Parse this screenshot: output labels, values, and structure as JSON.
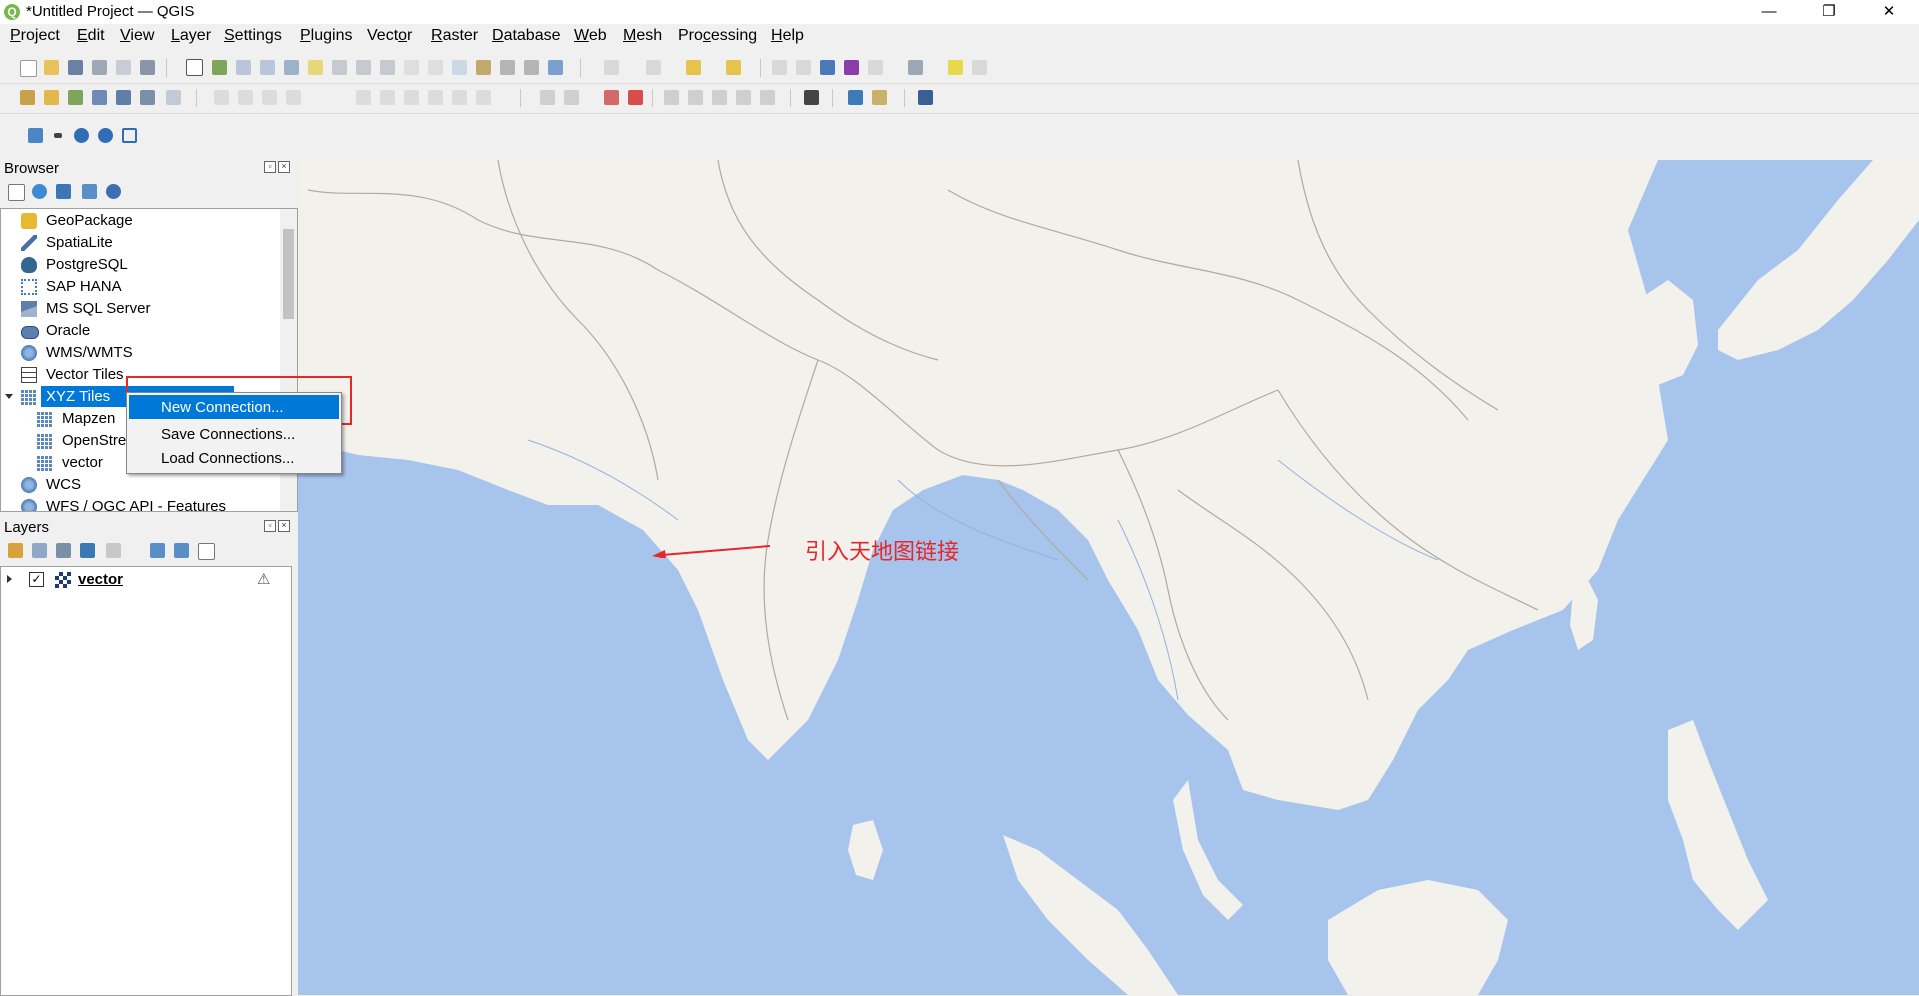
{
  "window": {
    "title": "*Untitled Project — QGIS",
    "logo_letter": "Q",
    "controls": {
      "minimize": "—",
      "restore": "❐",
      "close": "✕"
    }
  },
  "menus": [
    {
      "label_u": "P",
      "label_rest": "roject"
    },
    {
      "label_u": "E",
      "label_rest": "dit"
    },
    {
      "label_u": "V",
      "label_rest": "iew"
    },
    {
      "label_u": "L",
      "label_rest": "ayer"
    },
    {
      "label_u": "S",
      "label_rest": "ettings"
    },
    {
      "label_u": "P",
      "label_rest": "lugins"
    },
    {
      "label_pre": "Vect",
      "label_u": "o",
      "label_rest": "r"
    },
    {
      "label_u": "R",
      "label_rest": "aster"
    },
    {
      "label_u": "D",
      "label_rest": "atabase"
    },
    {
      "label_u": "W",
      "label_rest": "eb"
    },
    {
      "label_u": "M",
      "label_rest": "esh"
    },
    {
      "label_pre": "Pro",
      "label_u": "c",
      "label_rest": "essing"
    },
    {
      "label_u": "H",
      "label_rest": "elp"
    }
  ],
  "browser": {
    "title": "Browser",
    "items": [
      {
        "label": "GeoPackage",
        "icon": "geopackage-icon",
        "color": "#e8b830"
      },
      {
        "label": "SpatiaLite",
        "icon": "spatialite-icon",
        "color": "#4a6fa5"
      },
      {
        "label": "PostgreSQL",
        "icon": "postgresql-icon",
        "color": "#336791"
      },
      {
        "label": "SAP HANA",
        "icon": "sap-hana-icon",
        "color": "#3c7fc1"
      },
      {
        "label": "MS SQL Server",
        "icon": "mssql-icon",
        "color": "#5f7fa8"
      },
      {
        "label": "Oracle",
        "icon": "oracle-icon",
        "color": "#5b7fb0"
      },
      {
        "label": "WMS/WMTS",
        "icon": "globe-icon",
        "color": "#4a7ab8"
      },
      {
        "label": "Vector Tiles",
        "icon": "grid-icon",
        "color": "#444444"
      },
      {
        "label": "XYZ Tiles",
        "icon": "xyz-tiles-icon",
        "color": "#5b87c4"
      },
      {
        "label": "Mapzen",
        "icon": "tiles-icon",
        "color": "#5b87c4"
      },
      {
        "label": "OpenStre",
        "icon": "tiles-icon",
        "color": "#5b87c4"
      },
      {
        "label": "vector",
        "icon": "tiles-icon",
        "color": "#5b87c4"
      },
      {
        "label": "WCS",
        "icon": "globe-icon",
        "color": "#4a7ab8"
      },
      {
        "label": "WFS / OGC API - Features",
        "icon": "globe-icon",
        "color": "#4a7ab8"
      }
    ]
  },
  "context_menu": {
    "items": [
      "New Connection...",
      "Save Connections...",
      "Load Connections..."
    ]
  },
  "layers": {
    "title": "Layers",
    "items": [
      {
        "label": "vector",
        "checked": "✓",
        "warning": "⚠"
      }
    ]
  },
  "annotation": {
    "text": "引入天地图链接"
  },
  "colors": {
    "water": "#a6c4ec",
    "land": "#f3f1ec",
    "border": "#b5a89a",
    "annotation": "#e8262a",
    "selection": "#0078d7"
  }
}
